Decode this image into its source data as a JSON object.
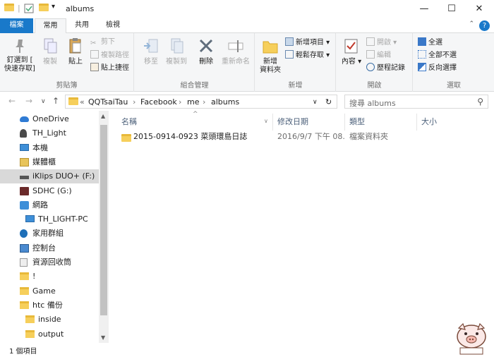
{
  "window": {
    "title": "albums",
    "quick_access_glyph": "▾",
    "controls": {
      "minimize": "—",
      "maximize": "☐",
      "close": "✕"
    }
  },
  "ribbon_tabs": {
    "file": "檔案",
    "home": "常用",
    "share": "共用",
    "view": "檢視"
  },
  "ribbon": {
    "groups": {
      "clipboard": "剪貼簿",
      "organize": "組合管理",
      "new": "新增",
      "open": "開啟",
      "select": "選取"
    },
    "buttons": {
      "pin": "釘選到 [",
      "pin_line2": "快速存取]",
      "copy": "複製",
      "paste": "貼上",
      "cut": "剪下",
      "copy_path": "複製路徑",
      "paste_shortcut": "貼上捷徑",
      "move_to": "移至",
      "copy_to": "複製到",
      "delete": "刪除",
      "rename": "重新命名",
      "new_folder": "新增",
      "new_folder_line2": "資料夾",
      "new_item": "新增項目",
      "easy_access": "輕鬆存取",
      "properties": "內容",
      "open": "開啟",
      "edit": "編輯",
      "history": "歷程記錄",
      "select_all": "全選",
      "select_none": "全部不選",
      "invert_selection": "反向選擇"
    }
  },
  "address": {
    "prefix": "«",
    "crumbs": [
      "QQTsaiTau",
      "Facebook",
      "me",
      "albums"
    ],
    "separator": "›",
    "search_placeholder": "搜尋 albums"
  },
  "sidebar": {
    "items": [
      {
        "label": "OneDrive",
        "icon": "cloud-icon",
        "indent": 1
      },
      {
        "label": "TH_Light",
        "icon": "user-icon",
        "indent": 1
      },
      {
        "label": "本機",
        "icon": "pc-icon",
        "indent": 1
      },
      {
        "label": "媒體櫃",
        "icon": "library-icon",
        "indent": 1
      },
      {
        "label": "iKlips DUO+ (F:)",
        "icon": "usb-drive-icon",
        "indent": 1,
        "selected": true
      },
      {
        "label": "SDHC (G:)",
        "icon": "sd-card-icon",
        "indent": 1
      },
      {
        "label": "網路",
        "icon": "network-icon",
        "indent": 1
      },
      {
        "label": "TH_LIGHT-PC",
        "icon": "pc-icon",
        "indent": 2
      },
      {
        "label": "家用群組",
        "icon": "homegroup-icon",
        "indent": 1
      },
      {
        "label": "控制台",
        "icon": "control-panel-icon",
        "indent": 1
      },
      {
        "label": "資源回收筒",
        "icon": "recycle-bin-icon",
        "indent": 1
      },
      {
        "label": "!",
        "icon": "folder-icon",
        "indent": 1
      },
      {
        "label": "Game",
        "icon": "folder-icon",
        "indent": 1
      },
      {
        "label": "htc 備份",
        "icon": "folder-icon",
        "indent": 1
      },
      {
        "label": "inside",
        "icon": "folder-icon",
        "indent": 2
      },
      {
        "label": "output",
        "icon": "folder-icon",
        "indent": 2
      }
    ]
  },
  "columns": {
    "name": "名稱",
    "date": "修改日期",
    "type": "類型",
    "size": "大小"
  },
  "files": [
    {
      "name": "2015-0914-0923 菜頭環島日誌",
      "date": "2016/9/7 下午 08...",
      "type": "檔案資料夾",
      "size": ""
    }
  ],
  "status": {
    "count": "1 個項目"
  },
  "colors": {
    "accent": "#1979ca",
    "folder": "#f6cf5b",
    "selected": "#d9d9d9"
  }
}
